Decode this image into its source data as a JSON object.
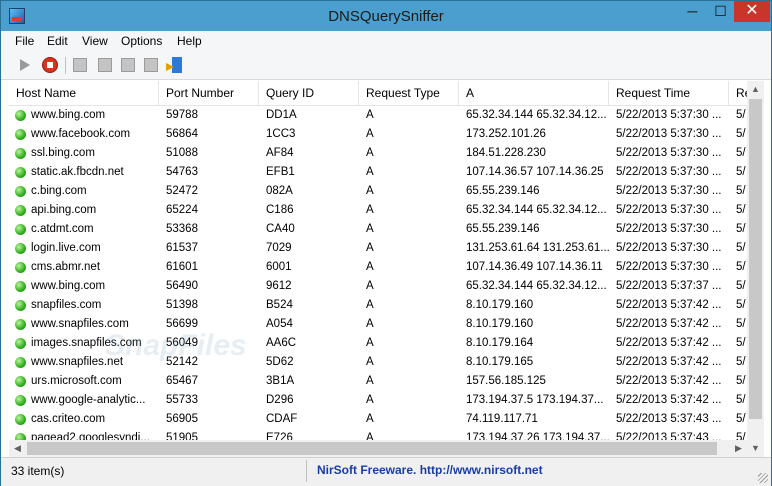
{
  "window": {
    "title": "DNSQuerySniffer",
    "min_glyph": "─",
    "max_glyph": "☐",
    "close_glyph": "✕"
  },
  "menu": [
    "File",
    "Edit",
    "View",
    "Options",
    "Help"
  ],
  "toolbar": {
    "icons": [
      "play-icon",
      "stop-icon",
      "save-icon",
      "copy-icon",
      "properties-icon",
      "html-report-icon",
      "exit-icon"
    ]
  },
  "table": {
    "columns": [
      "Host Name",
      "Port Number",
      "Query ID",
      "Request Type",
      "A",
      "Request Time",
      "Re"
    ],
    "rows": [
      {
        "host": "www.bing.com",
        "port": "59788",
        "qid": "DD1A",
        "type": "A",
        "a": "65.32.34.144  65.32.34.12...",
        "time": "5/22/2013 5:37:30 ...",
        "extra": "5/"
      },
      {
        "host": "www.facebook.com",
        "port": "56864",
        "qid": "1CC3",
        "type": "A",
        "a": "173.252.101.26",
        "time": "5/22/2013 5:37:30 ...",
        "extra": "5/"
      },
      {
        "host": "ssl.bing.com",
        "port": "51088",
        "qid": "AF84",
        "type": "A",
        "a": "184.51.228.230",
        "time": "5/22/2013 5:37:30 ...",
        "extra": "5/"
      },
      {
        "host": "static.ak.fbcdn.net",
        "port": "54763",
        "qid": "EFB1",
        "type": "A",
        "a": "107.14.36.57  107.14.36.25",
        "time": "5/22/2013 5:37:30 ...",
        "extra": "5/"
      },
      {
        "host": "c.bing.com",
        "port": "52472",
        "qid": "082A",
        "type": "A",
        "a": "65.55.239.146",
        "time": "5/22/2013 5:37:30 ...",
        "extra": "5/"
      },
      {
        "host": "api.bing.com",
        "port": "65224",
        "qid": "C186",
        "type": "A",
        "a": "65.32.34.144  65.32.34.12...",
        "time": "5/22/2013 5:37:30 ...",
        "extra": "5/"
      },
      {
        "host": "c.atdmt.com",
        "port": "53368",
        "qid": "CA40",
        "type": "A",
        "a": "65.55.239.146",
        "time": "5/22/2013 5:37:30 ...",
        "extra": "5/"
      },
      {
        "host": "login.live.com",
        "port": "61537",
        "qid": "7029",
        "type": "A",
        "a": "131.253.61.64  131.253.61...",
        "time": "5/22/2013 5:37:30 ...",
        "extra": "5/"
      },
      {
        "host": "cms.abmr.net",
        "port": "61601",
        "qid": "6001",
        "type": "A",
        "a": "107.14.36.49  107.14.36.11",
        "time": "5/22/2013 5:37:30 ...",
        "extra": "5/"
      },
      {
        "host": "www.bing.com",
        "port": "56490",
        "qid": "9612",
        "type": "A",
        "a": "65.32.34.144  65.32.34.12...",
        "time": "5/22/2013 5:37:37 ...",
        "extra": "5/"
      },
      {
        "host": "snapfiles.com",
        "port": "51398",
        "qid": "B524",
        "type": "A",
        "a": "8.10.179.160",
        "time": "5/22/2013 5:37:42 ...",
        "extra": "5/"
      },
      {
        "host": "www.snapfiles.com",
        "port": "56699",
        "qid": "A054",
        "type": "A",
        "a": "8.10.179.160",
        "time": "5/22/2013 5:37:42 ...",
        "extra": "5/"
      },
      {
        "host": "images.snapfiles.com",
        "port": "56049",
        "qid": "AA6C",
        "type": "A",
        "a": "8.10.179.164",
        "time": "5/22/2013 5:37:42 ...",
        "extra": "5/"
      },
      {
        "host": "www.snapfiles.net",
        "port": "52142",
        "qid": "5D62",
        "type": "A",
        "a": "8.10.179.165",
        "time": "5/22/2013 5:37:42 ...",
        "extra": "5/"
      },
      {
        "host": "urs.microsoft.com",
        "port": "65467",
        "qid": "3B1A",
        "type": "A",
        "a": "157.56.185.125",
        "time": "5/22/2013 5:37:42 ...",
        "extra": "5/"
      },
      {
        "host": "www.google-analytic...",
        "port": "55733",
        "qid": "D296",
        "type": "A",
        "a": "173.194.37.5  173.194.37...",
        "time": "5/22/2013 5:37:42 ...",
        "extra": "5/"
      },
      {
        "host": "cas.criteo.com",
        "port": "56905",
        "qid": "CDAF",
        "type": "A",
        "a": "74.119.117.71",
        "time": "5/22/2013 5:37:43 ...",
        "extra": "5/"
      },
      {
        "host": "pagead2.googlesyndi...",
        "port": "51905",
        "qid": "E726",
        "type": "A",
        "a": "173.194.37.26  173.194.37...",
        "time": "5/22/2013 5:37:43 ...",
        "extra": "5/"
      }
    ]
  },
  "watermark": "SnapFiles",
  "status": {
    "count": "33 item(s)",
    "link": "NirSoft Freeware.  http://www.nirsoft.net"
  },
  "scroll_glyphs": {
    "up": "▲",
    "down": "▼",
    "left": "◀",
    "right": "▶"
  }
}
